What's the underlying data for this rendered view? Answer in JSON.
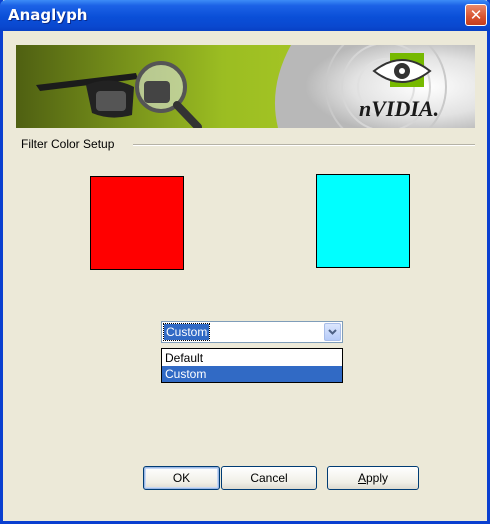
{
  "window": {
    "title": "Anaglyph",
    "close_glyph": "✕"
  },
  "banner": {
    "brand": "nVIDIA.",
    "images": [
      "stereo-glasses-image",
      "magnifier-image",
      "nvidia-eye-logo"
    ]
  },
  "filter_group": {
    "label": "Filter Color Setup",
    "left_color": "#ff0000",
    "right_color": "#00ffff"
  },
  "preset": {
    "selected": "Custom",
    "options": [
      "Default",
      "Custom"
    ],
    "highlighted_option": "Custom"
  },
  "buttons": {
    "ok": "OK",
    "cancel": "Cancel",
    "apply_mnemonic": "A",
    "apply_rest": "pply"
  },
  "colors": {
    "titlebar": "#0a4fd8",
    "selection": "#316ac5",
    "dialog_background": "#ece9d8"
  }
}
